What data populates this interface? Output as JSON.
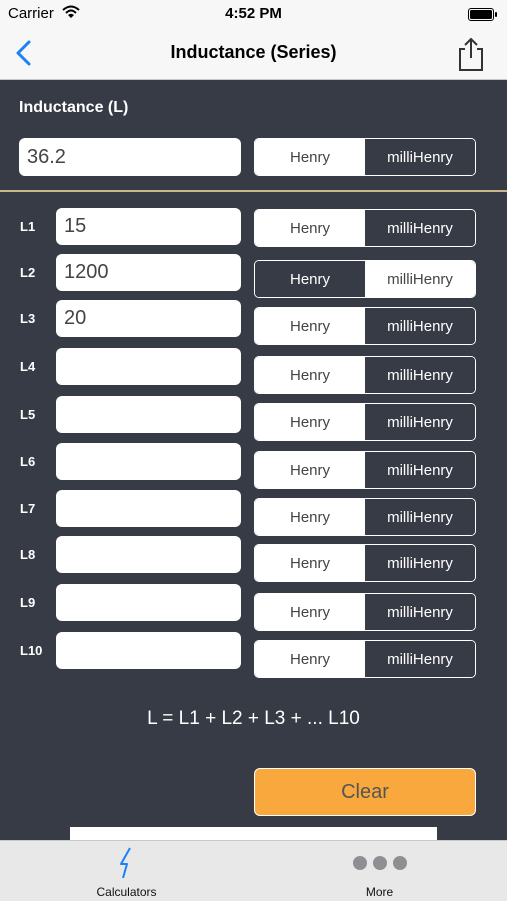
{
  "status_bar": {
    "carrier": "Carrier",
    "time": "4:52 PM"
  },
  "nav": {
    "title": "Inductance (Series)"
  },
  "result": {
    "label": "Inductance (L)",
    "value": "36.2",
    "unit_options": [
      "Henry",
      "milliHenry"
    ],
    "selected_unit": "milliHenry"
  },
  "inputs": [
    {
      "label": "L1",
      "value": "15",
      "selected_unit": "milliHenry"
    },
    {
      "label": "L2",
      "value": "1200",
      "selected_unit": "Henry"
    },
    {
      "label": "L3",
      "value": "20",
      "selected_unit": "milliHenry"
    },
    {
      "label": "L4",
      "value": "",
      "selected_unit": "milliHenry"
    },
    {
      "label": "L5",
      "value": "",
      "selected_unit": "milliHenry"
    },
    {
      "label": "L6",
      "value": "",
      "selected_unit": "milliHenry"
    },
    {
      "label": "L7",
      "value": "",
      "selected_unit": "milliHenry"
    },
    {
      "label": "L8",
      "value": "",
      "selected_unit": "milliHenry"
    },
    {
      "label": "L9",
      "value": "",
      "selected_unit": "milliHenry"
    },
    {
      "label": "L10",
      "value": "",
      "selected_unit": "milliHenry"
    }
  ],
  "unit_options": [
    "Henry",
    "milliHenry"
  ],
  "formula": "L = L1 + L2 + L3 + ... L10",
  "clear_label": "Clear",
  "tabs": [
    {
      "label": "Calculators",
      "icon": "lightning-bolt-icon",
      "active": true
    },
    {
      "label": "More",
      "icon": "more-dots-icon",
      "active": false
    }
  ],
  "colors": {
    "background": "#373b45",
    "accent_button": "#f8a83c",
    "active_tab": "#1a82f7",
    "divider": "#c9b68a"
  }
}
